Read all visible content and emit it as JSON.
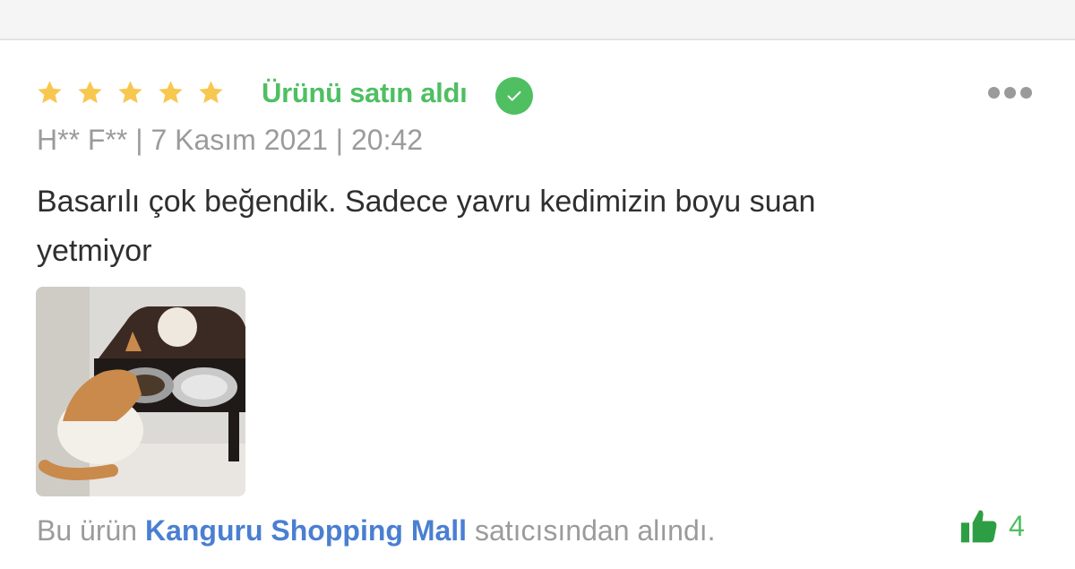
{
  "review": {
    "rating": 5,
    "rating_max": 5,
    "purchased_label": "Ürünü satın aldı",
    "author": "H** F**",
    "separator": "|",
    "date": "7 Kasım 2021",
    "time": "20:42",
    "comment": "Basarılı çok beğendik. Sadece yavru kedimizin boyu suan yetmiyor",
    "seller_prefix": "Bu ürün",
    "seller_name": "Kanguru Shopping Mall",
    "seller_suffix": "satıcısından alındı.",
    "like_count": "4"
  },
  "icons": {
    "star": "star-icon",
    "verified": "check-circle-icon",
    "menu": "more-horizontal-icon",
    "like": "thumbs-up-icon"
  },
  "colors": {
    "star": "#f8c74f",
    "verified_green": "#4fbf62",
    "seller_link": "#4a7fd1",
    "muted_text": "#9b9b9b",
    "body_text": "#2f2f2f"
  }
}
